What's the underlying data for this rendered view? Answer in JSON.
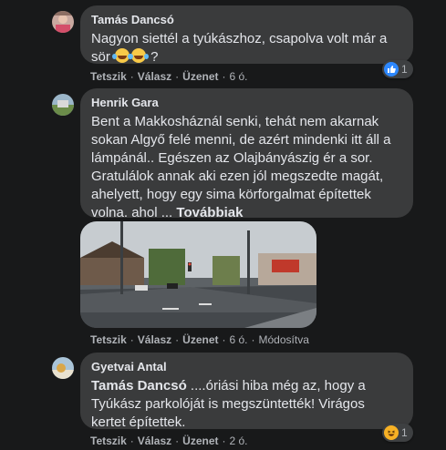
{
  "comments": [
    {
      "author": "Tamás Dancsó",
      "text_before_emoji": "Nagyon siettél a tyúkászhoz, csapolva volt már a sör ",
      "text_after_emoji": " ?",
      "emoji_icons": [
        "rofl-emoji-icon",
        "rofl-emoji-icon"
      ],
      "actions": {
        "like": "Tetszik",
        "reply": "Válasz",
        "message": "Üzenet",
        "time": "6 ó."
      },
      "reaction": {
        "icon": "like-reaction-icon",
        "count": "1",
        "color": "#2d88ff"
      }
    },
    {
      "author": "Henrik Gara",
      "text": "Bent a Makkosháznál senki, tehát nem akarnak sokan Algyő felé menni, de azért mindenki itt áll a lámpánál.. Egészen az Olajbányászig ér a sor. Gratulálok annak aki ezen jól megszedte magát, ahelyett, hogy egy sima körforgalmat építettek volna. ahol ...",
      "more": "Továbbiak",
      "photo": "street-traffic-photo",
      "actions": {
        "like": "Tetszik",
        "reply": "Válasz",
        "message": "Üzenet",
        "time": "6 ó.",
        "edited": "Módosítva"
      }
    },
    {
      "author": "Gyetvai Antal",
      "mention": "Tamás Dancsó",
      "text": " ....óriási hiba még az, hogy a Tyúkász parkolóját is megszüntették! Virágos kertet építettek.",
      "actions": {
        "like": "Tetszik",
        "reply": "Válasz",
        "message": "Üzenet",
        "time": "2 ó."
      },
      "reaction": {
        "icon": "haha-reaction-icon",
        "count": "1",
        "color": "#f7b125"
      }
    }
  ]
}
